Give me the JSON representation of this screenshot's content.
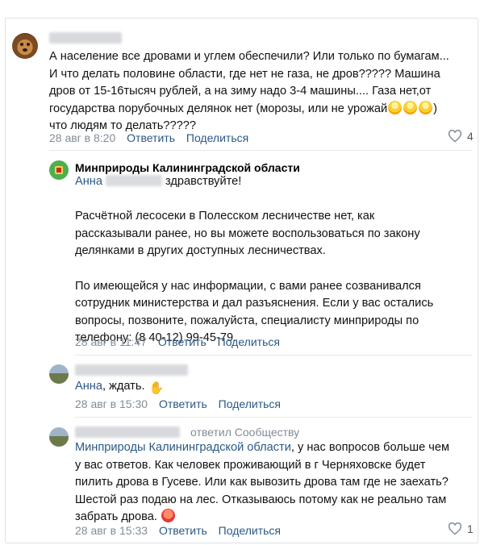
{
  "comments": [
    {
      "author": "",
      "text_lines": [
        "А население все дровами и углем обеспечили? Или только по бумагам...",
        "И что делать половине области, где нет не газа, не дров????? Машина",
        "дров от 15-16тысяч рублей, а на зиму надо 3-4 машины.... Газа нет,от",
        "государства порубочных делянок нет (морозы, или не урожай",
        "что людям то делать?????"
      ],
      "emoji_suffix": "face-screaming-in-fear x3",
      "time": "28 авг в 8:20",
      "reply_label": "Ответить",
      "share_label": "Поделиться",
      "likes": "4"
    },
    {
      "author": "Минприроды Калининградской области",
      "mention": "Анна",
      "greeting": "здравствуйте!",
      "text_lines": [
        "Расчётной лесосеки в Полесском лесничестве нет, как",
        "рассказывали ранее, но вы можете воспользоваться по закону",
        "делянками в других доступных лесничествах.",
        "",
        "По имеющейся у нас информации, с вами ранее созванивался",
        "сотрудник министерства и дал разъяснения. Если у вас остались",
        "вопросы, позвоните, пожалуйста, специалисту минприроды по",
        "телефону: (8 40-12) 99-45-79."
      ],
      "time": "28 авг в 11:47",
      "reply_label": "Ответить",
      "share_label": "Поделиться"
    },
    {
      "author": "",
      "mention": "Анна",
      "text": ", ждать.",
      "emoji_suffix": "flexed-biceps",
      "time": "28 авг в 15:30",
      "reply_label": "Ответить",
      "share_label": "Поделиться"
    },
    {
      "author": "",
      "replied_to": "ответил Сообществу",
      "mention": "Минприроды Калининградской области",
      "text_first": ", у нас вопросов больше чем",
      "text_lines": [
        "у вас ответов. Как человек проживающий в г Черняховске будет",
        "пилить дрова в Гусеве. Или как вывозить дрова там где не заехать?",
        "Шестой раз подаю на лес. Отказываюсь потому как не реально там",
        "забрать дрова."
      ],
      "emoji_suffix": "angry-face",
      "time": "28 авг в 15:33",
      "reply_label": "Ответить",
      "share_label": "Поделиться",
      "likes": "1"
    }
  ],
  "colors": {
    "link": "#2a5885",
    "meta": "#818c99",
    "border": "#dfe1e5"
  },
  "icons": [
    "heart-icon",
    "dog-avatar",
    "ministry-logo-avatar",
    "user-avatar"
  ]
}
